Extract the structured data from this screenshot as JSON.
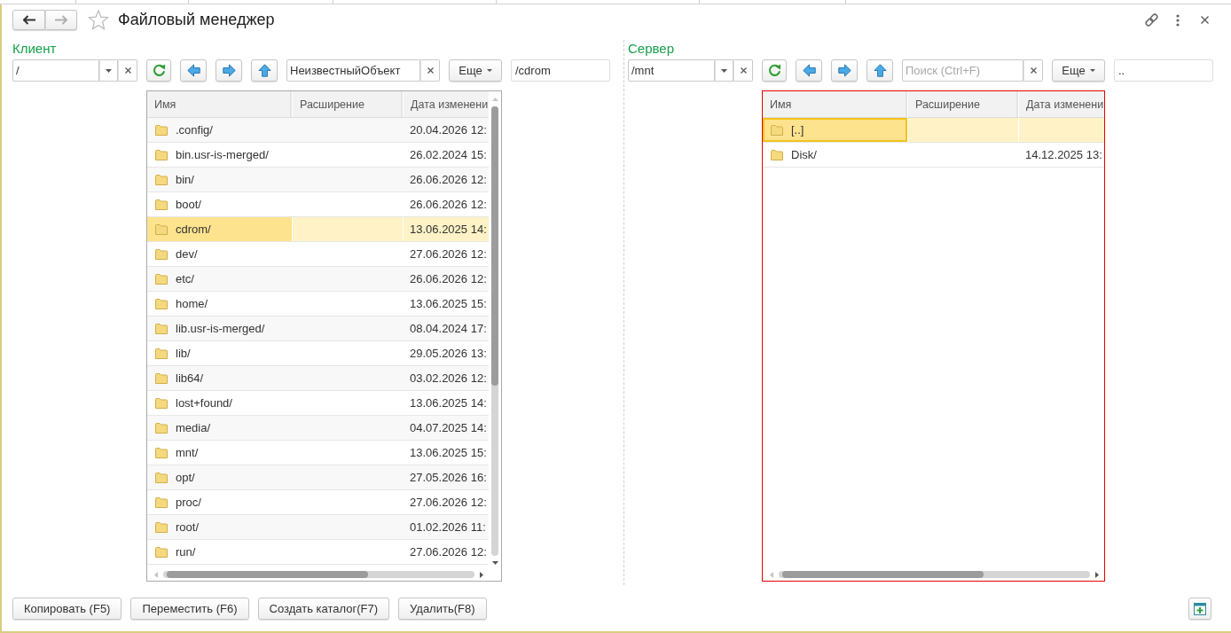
{
  "window": {
    "title": "Файловый менеджер",
    "favorite": false,
    "navigation": [
      {
        "kind": "back",
        "disabled": false
      },
      {
        "kind": "forward",
        "disabled": true
      }
    ]
  },
  "panels": [
    {
      "title": "Клиент",
      "path_selector": {
        "value": "/"
      },
      "search": {
        "value": "НеизвестныйОбъект"
      },
      "more_button": "Еще",
      "current_path": "/cdrom",
      "table": {
        "focused": false,
        "vertical_scroll": true,
        "columns": [
          "Имя",
          "Расширение",
          "Дата изменени"
        ],
        "rows": [
          {
            "name": ".config/",
            "modified": "20.04.2026 12:",
            "selected": false
          },
          {
            "name": "bin.usr-is-merged/",
            "modified": "26.02.2024 15:",
            "selected": false
          },
          {
            "name": "bin/",
            "modified": "26.06.2026 12:",
            "selected": false
          },
          {
            "name": "boot/",
            "modified": "26.06.2026 12:",
            "selected": false
          },
          {
            "name": "cdrom/",
            "modified": "13.06.2025 14:",
            "selected": true
          },
          {
            "name": "dev/",
            "modified": "27.06.2026 12:",
            "selected": false
          },
          {
            "name": "etc/",
            "modified": "26.06.2026 12:",
            "selected": false
          },
          {
            "name": "home/",
            "modified": "13.06.2025 15:",
            "selected": false
          },
          {
            "name": "lib.usr-is-merged/",
            "modified": "08.04.2024 17:",
            "selected": false
          },
          {
            "name": "lib/",
            "modified": "29.05.2026 13:",
            "selected": false
          },
          {
            "name": "lib64/",
            "modified": "03.02.2026 12:",
            "selected": false
          },
          {
            "name": "lost+found/",
            "modified": "13.06.2025 14:",
            "selected": false
          },
          {
            "name": "media/",
            "modified": "04.07.2025 14:",
            "selected": false
          },
          {
            "name": "mnt/",
            "modified": "13.06.2025 15:",
            "selected": false
          },
          {
            "name": "opt/",
            "modified": "27.05.2026 16:",
            "selected": false
          },
          {
            "name": "proc/",
            "modified": "27.06.2026 12:",
            "selected": false
          },
          {
            "name": "root/",
            "modified": "01.02.2026 11:",
            "selected": false
          },
          {
            "name": "run/",
            "modified": "27.06.2026 12:",
            "selected": false
          }
        ]
      }
    },
    {
      "title": "Сервер",
      "path_selector": {
        "value": "/mnt"
      },
      "search": {
        "placeholder": "Поиск (Ctrl+F)"
      },
      "more_button": "Еще",
      "current_path": "..",
      "table": {
        "focused": true,
        "vertical_scroll": false,
        "columns": [
          "Имя",
          "Расширение",
          "Дата изменени"
        ],
        "rows": [
          {
            "name": "[..]",
            "selected": true
          },
          {
            "name": "Disk/",
            "modified": "14.12.2025 13:",
            "selected": false
          }
        ]
      }
    }
  ],
  "buttons": [
    "Копировать (F5)",
    "Переместить (F6)",
    "Создать каталог(F7)",
    "Удалить(F8)"
  ]
}
